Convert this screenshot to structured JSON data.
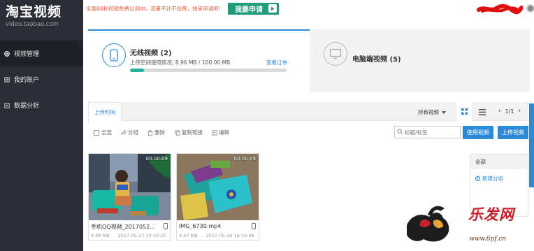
{
  "sidebar": {
    "logo_title": "淘宝视频",
    "logo_subtitle": "video.taobao.com",
    "items": [
      {
        "label": "视频管理",
        "icon": "video-manage-icon",
        "active": true
      },
      {
        "label": "我的账户",
        "icon": "account-icon",
        "active": false
      },
      {
        "label": "数据分析",
        "icon": "data-analysis-icon",
        "active": false
      }
    ]
  },
  "topbar": {
    "notice": "全面60秒视频免费公测中，流量不计不扣费，快来申请吧！",
    "apply_label": "我要申请",
    "user_avatar_icon": "user-avatar-icon"
  },
  "tabs": {
    "wireless": {
      "title": "无线视频 (2)",
      "usage": "上传空间使用情况: 8.96 MB / 100.00 MB",
      "view_order": "查看订单",
      "usage_ratio": 0.0896,
      "icon": "phone-icon"
    },
    "desktop": {
      "title": "电脑端视频 (5)",
      "icon": "monitor-icon"
    }
  },
  "toolbar": {
    "sort_tab": "上传时间",
    "filter": "所有视频",
    "pager": "1/1",
    "select_all": "全选",
    "group": "分组",
    "delete": "删除",
    "copy_link": "复制链接",
    "edit": "编辑",
    "search_placeholder": "标题/标签",
    "use_video": "使用视频",
    "upload_video": "上传视频"
  },
  "videos": [
    {
      "name": "手机QQ视频_2017052...",
      "duration": "00:00:09",
      "size": "4.49 MB",
      "date": "2017-05-27 10:33:25",
      "device_icon": "phone-icon"
    },
    {
      "name": "IMG_6730.mp4",
      "duration": "00:00:09",
      "size": "4.47 MB",
      "date": "2017-05-26 16:16:48",
      "device_icon": "phone-icon"
    }
  ],
  "groups": {
    "header": "全部",
    "new_group": "新建分组"
  },
  "watermark": {
    "brand": "乐发网",
    "url": "www.6pf.cn"
  },
  "colors": {
    "sidebar_bg": "#2a2d35",
    "accent_blue": "#2b8ad8",
    "apply_green": "#1f9a7a",
    "progress_teal": "#27b1a3",
    "notice_red": "#e85a3a"
  }
}
